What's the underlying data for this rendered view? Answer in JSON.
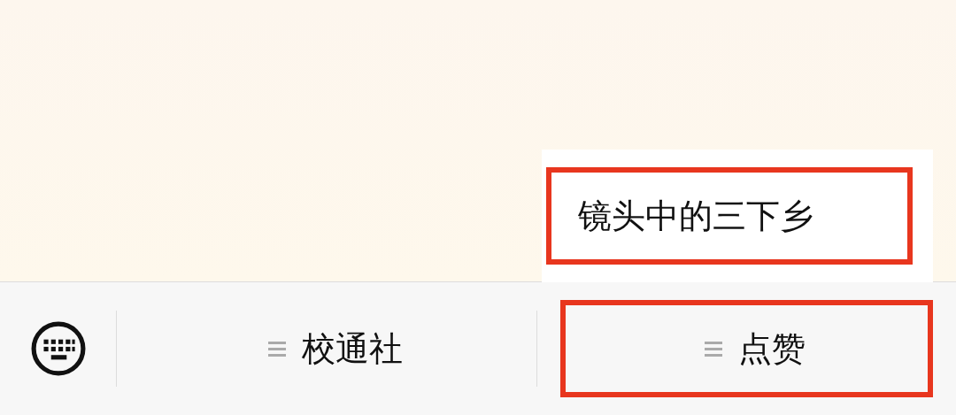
{
  "menu": [
    {
      "label": "校通社",
      "highlighted": false
    },
    {
      "label": "点赞",
      "highlighted": true,
      "submenu": [
        {
          "label": "镜头中的三下乡",
          "highlighted": true
        }
      ]
    }
  ]
}
